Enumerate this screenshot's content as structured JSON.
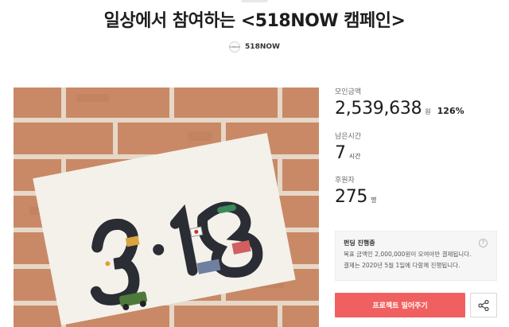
{
  "title": "일상에서 참여하는 <518NOW 캠페인>",
  "maker": {
    "name": "518NOW",
    "avatar_text": "518NOW"
  },
  "stats": {
    "amount_label": "모인금액",
    "amount_value": "2,539,638",
    "amount_unit": "원",
    "percent": "126%",
    "time_label": "남은시간",
    "time_value": "7",
    "time_unit": "시간",
    "backers_label": "후원자",
    "backers_value": "275",
    "backers_unit": "명"
  },
  "funding_info": {
    "title": "펀딩 진행중",
    "line1": "목표 금액인 2,000,000원이 모여야만 결제됩니다.",
    "line2": "결제는 2020년 5월 1일에 다함께 진행됩니다.",
    "help_icon": "?"
  },
  "actions": {
    "push_label": "프로젝트 밀어주기",
    "share_icon": "share-icon"
  },
  "colors": {
    "accent": "#f16060",
    "brick": "#c98967",
    "mortar": "#e8dccd"
  }
}
